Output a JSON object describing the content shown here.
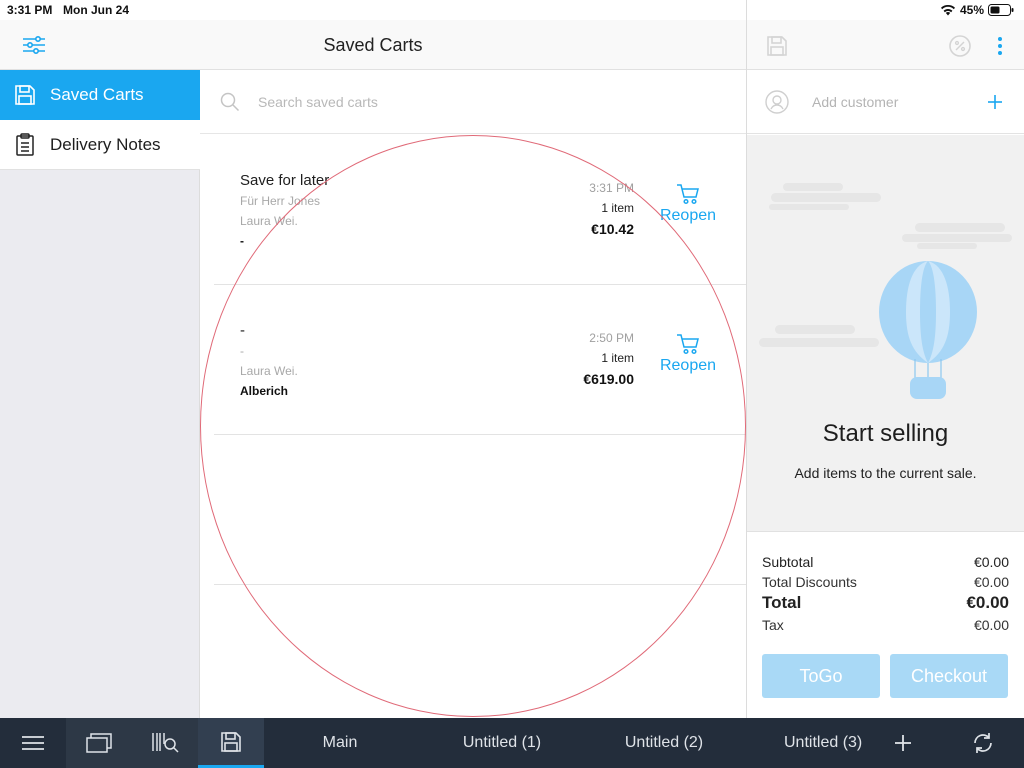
{
  "status_bar": {
    "time": "3:31 PM",
    "date": "Mon Jun 24",
    "battery": "45%"
  },
  "header": {
    "title": "Saved Carts"
  },
  "sidebar": {
    "items": [
      {
        "label": "Saved Carts",
        "icon": "floppy-disk-icon",
        "active": true
      },
      {
        "label": "Delivery Notes",
        "icon": "clipboard-icon",
        "active": false
      }
    ]
  },
  "search": {
    "placeholder": "Search saved carts",
    "value": ""
  },
  "carts": [
    {
      "name": "Save for later",
      "note": "Für Herr Jones",
      "staff": "Laura Wei.",
      "customer": "-",
      "time": "3:31 PM",
      "items": "1 item",
      "total": "€10.42",
      "action": "Reopen"
    },
    {
      "name": "-",
      "note": "-",
      "staff": "Laura Wei.",
      "customer": "Alberich",
      "time": "2:50 PM",
      "items": "1 item",
      "total": "€619.00",
      "action": "Reopen"
    }
  ],
  "right_panel": {
    "customer_placeholder": "Add customer",
    "empty_title": "Start selling",
    "empty_desc": "Add items to the current sale.",
    "totals": {
      "subtotal_label": "Subtotal",
      "subtotal": "€0.00",
      "discounts_label": "Total Discounts",
      "discounts": "€0.00",
      "total_label": "Total",
      "total": "€0.00",
      "tax_label": "Tax",
      "tax": "€0.00"
    },
    "togo_label": "ToGo",
    "checkout_label": "Checkout"
  },
  "bottom_bar": {
    "tabs": [
      "Main",
      "Untitled (1)",
      "Untitled (2)",
      "Untitled (3)"
    ]
  },
  "colors": {
    "accent": "#1aa7f0",
    "bottom_bar": "#232d3b",
    "annotation_circle": "#e06a78",
    "disabled_button": "#a9d9f6"
  }
}
